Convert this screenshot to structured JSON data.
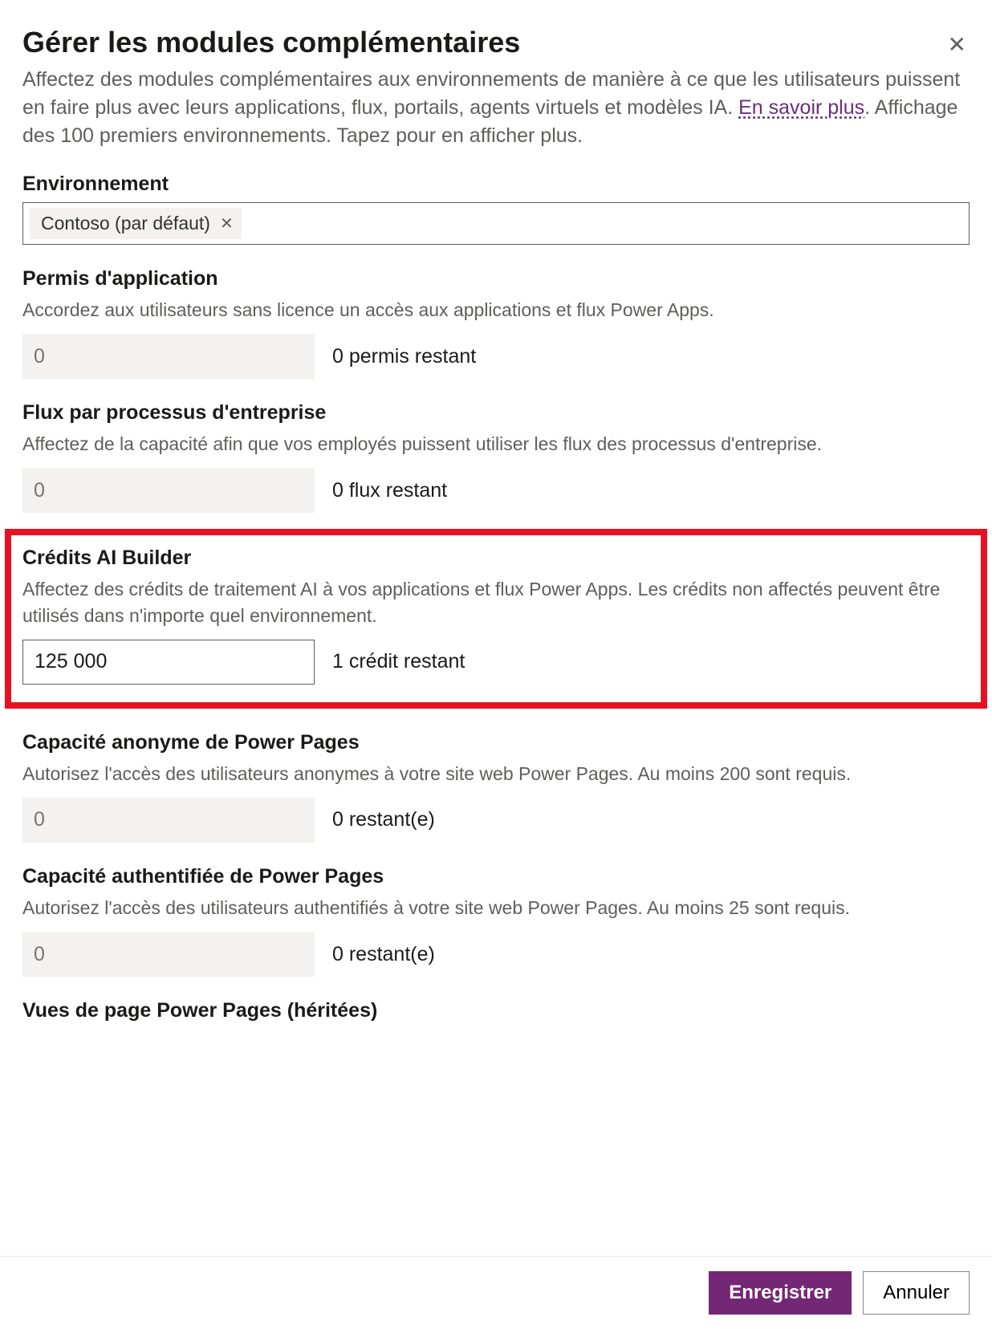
{
  "header": {
    "title": "Gérer les modules complémentaires",
    "intro_pre": "Affectez des modules complémentaires aux environnements de manière à ce que les utilisateurs puissent en faire plus avec leurs applications, flux, portails, agents virtuels et modèles IA. ",
    "learn_more": "En savoir plus",
    "intro_post": ". Affichage des 100 premiers environnements. Tapez pour en afficher plus."
  },
  "env": {
    "label": "Environnement",
    "chip": "Contoso (par défaut)"
  },
  "sections": [
    {
      "title": "Permis d'application",
      "desc": "Accordez aux utilisateurs sans licence un accès aux applications et flux Power Apps.",
      "value": "",
      "placeholder": "0",
      "remaining": "0 permis restant",
      "highlighted": false,
      "disabled": true
    },
    {
      "title": "Flux par processus d'entreprise",
      "desc": "Affectez de la capacité afin que vos employés puissent utiliser les flux des processus d'entreprise.",
      "value": "",
      "placeholder": "0",
      "remaining": "0 flux restant",
      "highlighted": false,
      "disabled": true
    },
    {
      "title": "Crédits AI Builder",
      "desc": "Affectez des crédits de traitement AI à vos applications et flux Power Apps. Les crédits non affectés peuvent être utilisés dans n'importe quel environnement.",
      "value": "125 000",
      "placeholder": "",
      "remaining": "1 crédit restant",
      "highlighted": true,
      "disabled": false
    },
    {
      "title": "Capacité anonyme de Power Pages",
      "desc": "Autorisez l'accès des utilisateurs anonymes à votre site web Power Pages. Au moins 200 sont requis.",
      "value": "",
      "placeholder": "0",
      "remaining": "0 restant(e)",
      "highlighted": false,
      "disabled": true
    },
    {
      "title": "Capacité authentifiée de Power Pages",
      "desc": "Autorisez l'accès des utilisateurs authentifiés à votre site web Power Pages. Au moins 25 sont requis.",
      "value": "",
      "placeholder": "0",
      "remaining": "0 restant(e)",
      "highlighted": false,
      "disabled": true
    },
    {
      "title": "Vues de page Power Pages (héritées)",
      "desc": "",
      "value": "",
      "placeholder": "",
      "remaining": "",
      "highlighted": false,
      "disabled": true,
      "title_only": true
    }
  ],
  "footer": {
    "save": "Enregistrer",
    "cancel": "Annuler"
  }
}
